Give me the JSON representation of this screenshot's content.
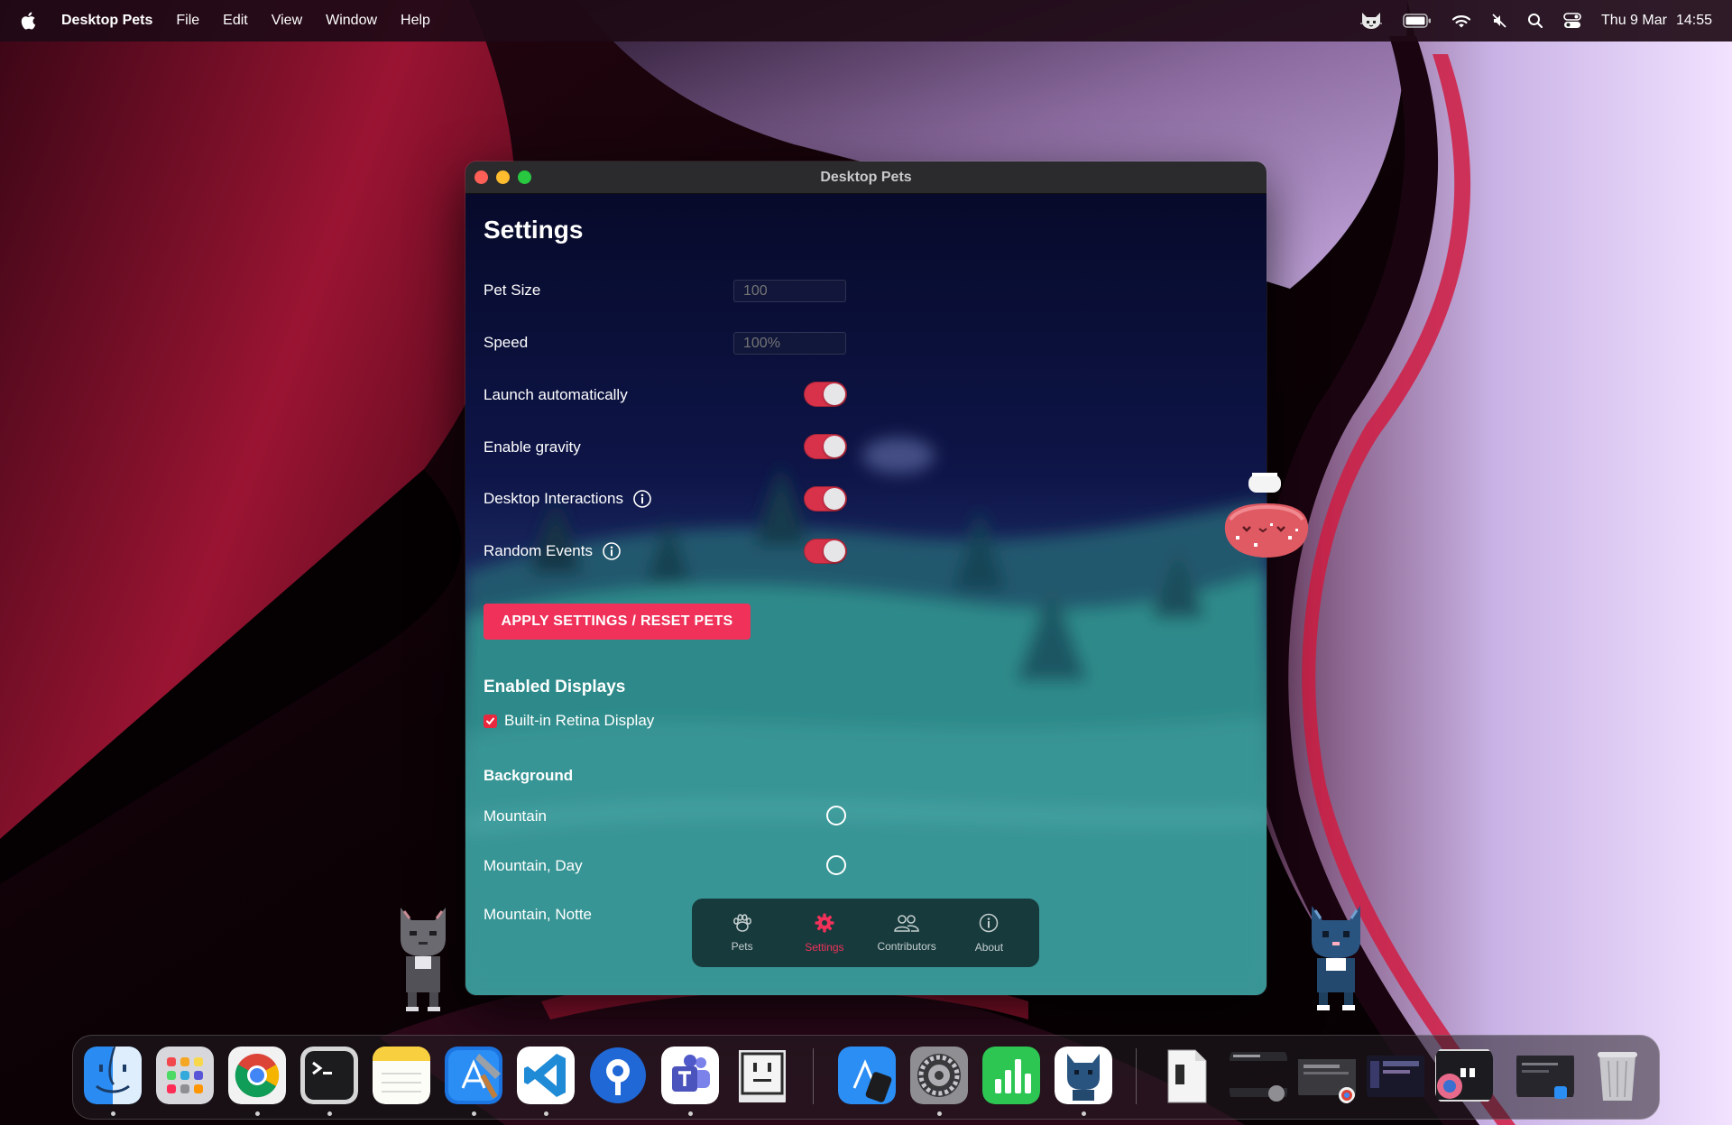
{
  "menubar": {
    "app_name": "Desktop Pets",
    "menus": [
      "File",
      "Edit",
      "View",
      "Window",
      "Help"
    ],
    "date": "Thu 9 Mar",
    "time": "14:55"
  },
  "window": {
    "title": "Desktop Pets"
  },
  "settings": {
    "page_title": "Settings",
    "pet_size_label": "Pet Size",
    "pet_size_placeholder": "100",
    "speed_label": "Speed",
    "speed_placeholder": "100%",
    "launch_label": "Launch automatically",
    "launch_on": true,
    "gravity_label": "Enable gravity",
    "gravity_on": true,
    "interactions_label": "Desktop Interactions",
    "interactions_on": true,
    "random_label": "Random Events",
    "random_on": true,
    "apply_button": "APPLY SETTINGS / RESET PETS",
    "displays_title": "Enabled Displays",
    "display_name": "Built-in Retina Display",
    "display_checked": true,
    "background_title": "Background",
    "backgrounds": [
      {
        "label": "Mountain",
        "selected": false
      },
      {
        "label": "Mountain, Day",
        "selected": false
      },
      {
        "label": "Mountain, Notte",
        "selected": false
      }
    ]
  },
  "tabbar": {
    "tabs": [
      {
        "label": "Pets",
        "active": false,
        "icon": "paw-icon"
      },
      {
        "label": "Settings",
        "active": true,
        "icon": "gear-icon"
      },
      {
        "label": "Contributors",
        "active": false,
        "icon": "people-icon"
      },
      {
        "label": "About",
        "active": false,
        "icon": "info-icon"
      }
    ]
  },
  "colors": {
    "accent": "#f0325a",
    "toggle_on": "#d8324a"
  },
  "dock": {
    "apps": [
      "Finder",
      "Launchpad",
      "Google Chrome",
      "Terminal",
      "Notes",
      "Xcode",
      "Visual Studio Code",
      "Sourcetree",
      "Microsoft Teams",
      "Desktop Pets helper",
      "Simulator",
      "System Settings",
      "Numbers",
      "Desktop Pets",
      "Documents",
      "Window 1",
      "Window 2",
      "Window 3",
      "Window 4",
      "Window 5",
      "Trash"
    ]
  }
}
